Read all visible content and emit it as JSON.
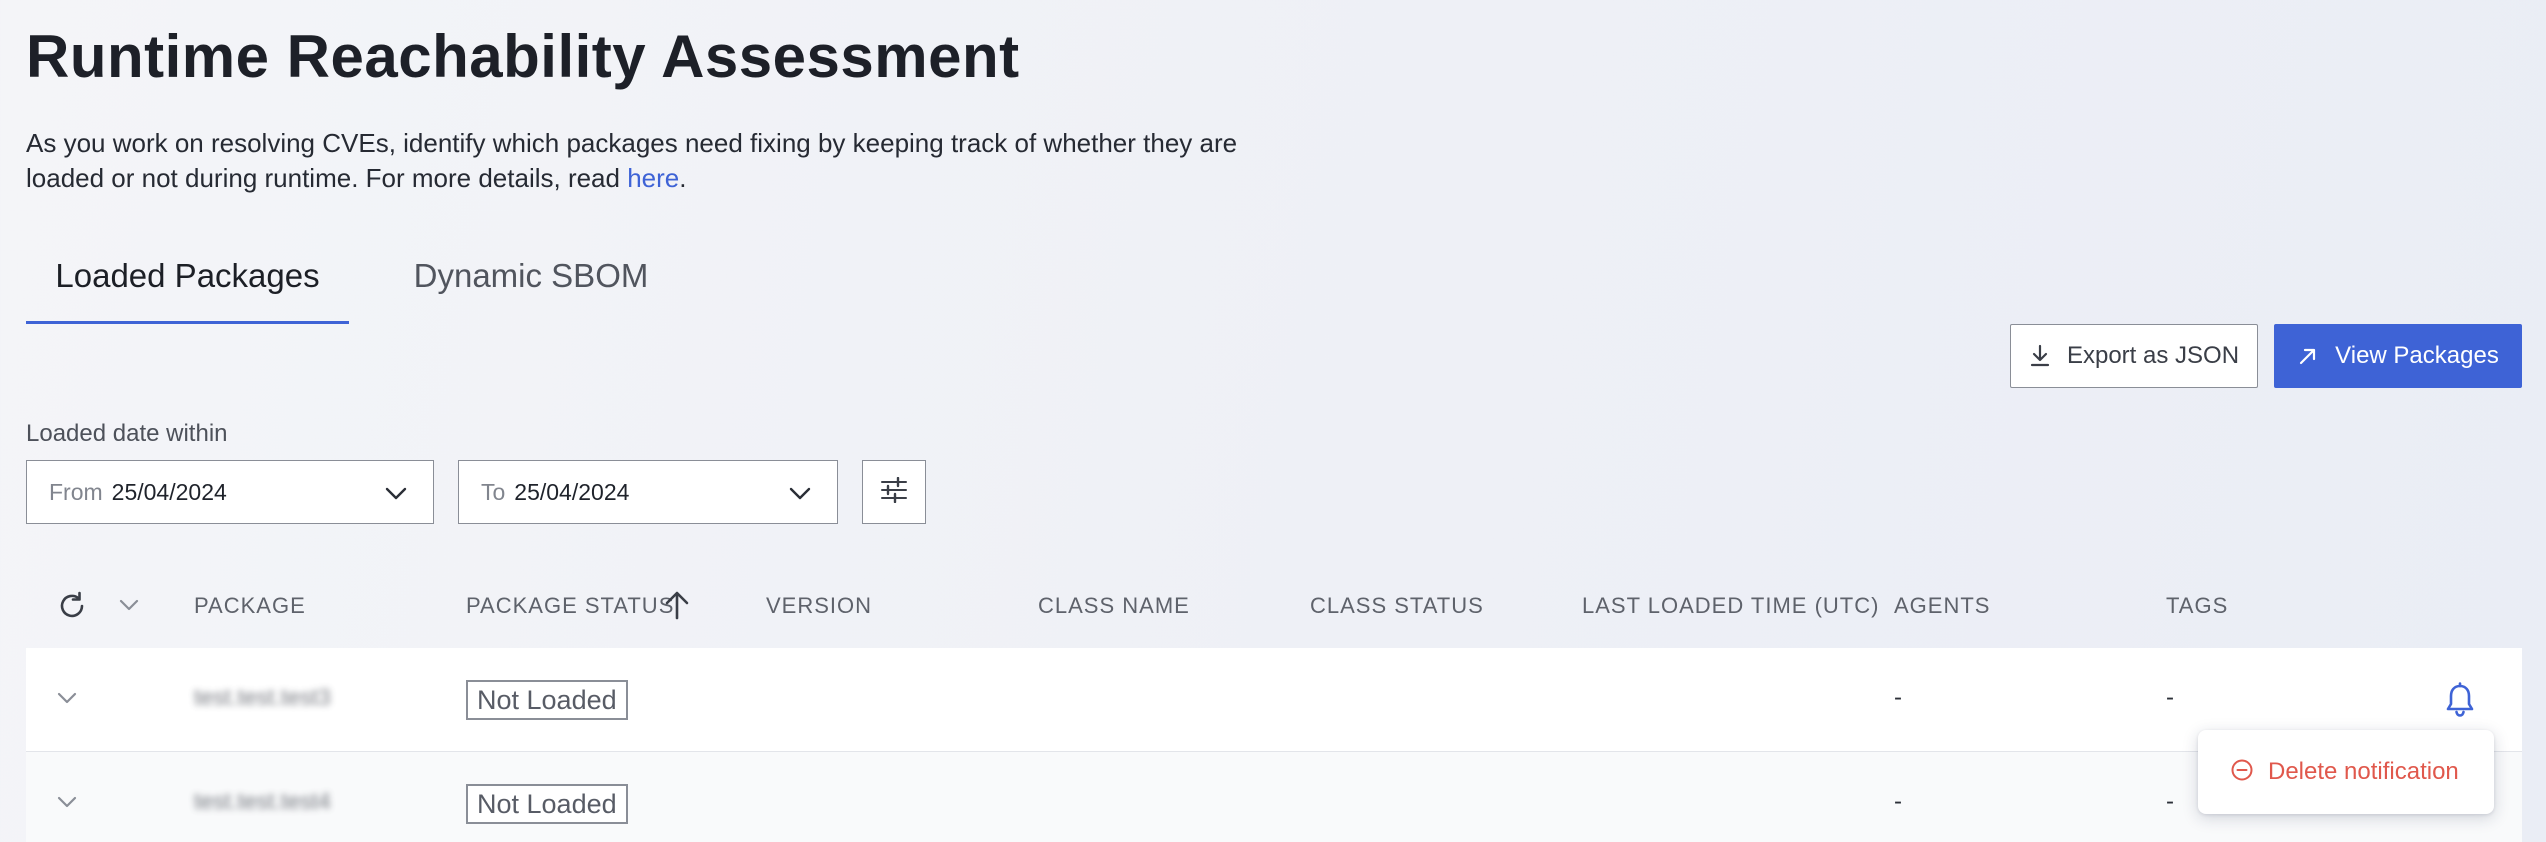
{
  "header": {
    "title": "Runtime Reachability Assessment",
    "description": "As you work on resolving CVEs, identify which packages need fixing by keeping track of whether they are loaded or not during runtime. For more details, read ",
    "link_text": "here",
    "description_end": "."
  },
  "tabs": [
    {
      "label": "Loaded Packages",
      "active": true
    },
    {
      "label": "Dynamic SBOM",
      "active": false
    }
  ],
  "toolbar": {
    "export_label": "Export as JSON",
    "view_label": "View Packages"
  },
  "filters": {
    "label": "Loaded date within",
    "from_prefix": "From",
    "from_value": "25/04/2024",
    "to_prefix": "To",
    "to_value": "25/04/2024"
  },
  "table": {
    "columns": [
      "PACKAGE",
      "PACKAGE STATUS",
      "VERSION",
      "CLASS NAME",
      "CLASS STATUS",
      "LAST LOADED TIME (UTC)",
      "AGENTS",
      "TAGS"
    ],
    "sorted_column": "PACKAGE STATUS",
    "rows": [
      {
        "package": "test.test.test3",
        "status": "Not Loaded",
        "agents": "-",
        "tags": "-"
      },
      {
        "package": "test.test.test4",
        "status": "Not Loaded",
        "agents": "-",
        "tags": "-"
      }
    ]
  },
  "popup": {
    "label": "Delete notification"
  },
  "colors": {
    "accent": "#3e63d6",
    "danger": "#e0584c"
  },
  "icons": {
    "export": "download-icon",
    "view": "arrow-up-right-icon",
    "adjust": "sliders-icon",
    "refresh": "refresh-icon",
    "sort": "arrow-up-icon",
    "notification": "bell-icon",
    "delete": "minus-circle-icon"
  }
}
